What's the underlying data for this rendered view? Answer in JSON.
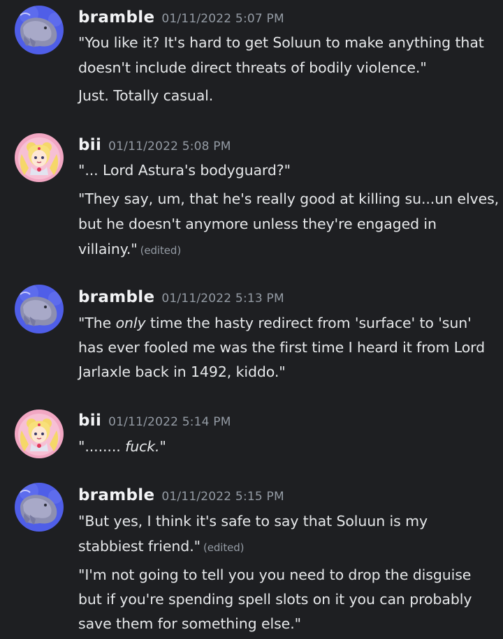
{
  "messages": [
    {
      "author": "bramble",
      "timestamp": "01/11/2022 5:07 PM",
      "avatar": "whale-avatar",
      "lines": [
        "\"You like it? It's hard to get Soluun to make anything that",
        "doesn't include direct threats of bodily violence.\"",
        "Just. Totally casual."
      ]
    },
    {
      "author": "bii",
      "timestamp": "01/11/2022 5:08 PM",
      "avatar": "sailor-moon-avatar",
      "lines": [
        "\"... Lord Astura's bodyguard?\"",
        "\"They say, um, that he's really good at killing su...un elves,",
        "but he doesn't anymore unless they're engaged in",
        "villainy.\""
      ],
      "edited_label": "(edited)"
    },
    {
      "author": "bramble",
      "timestamp": "01/11/2022 5:13 PM",
      "avatar": "whale-avatar",
      "lines_parts": {
        "pre": "\"The ",
        "emph": "only",
        "post": " time the hasty redirect from 'surface' to 'sun'"
      },
      "lines": [
        "has ever fooled me was the first time I heard it from Lord",
        "Jarlaxle back in 1492, kiddo.\""
      ]
    },
    {
      "author": "bii",
      "timestamp": "01/11/2022 5:14 PM",
      "avatar": "sailor-moon-avatar",
      "line_parts": {
        "pre": "\"........ ",
        "emph": "fuck.",
        "post": "\""
      }
    },
    {
      "author": "bramble",
      "timestamp": "01/11/2022 5:15 PM",
      "avatar": "whale-avatar",
      "lines": [
        "\"But yes, I think it's safe to say that Soluun is my",
        "stabbiest friend.\"",
        "\"I'm not going to tell you you need to drop the disguise",
        "but if you're spending spell slots on it you can probably",
        "save them for something else.\""
      ],
      "edited_label": "(edited)"
    }
  ],
  "colors": {
    "background": "#1e1f22",
    "username": "#f2f3f5",
    "timestamp": "#949ba4",
    "text": "#e6e8ea",
    "whale_bg": "#5865f2",
    "moon_bg": "#f2a7c3"
  }
}
